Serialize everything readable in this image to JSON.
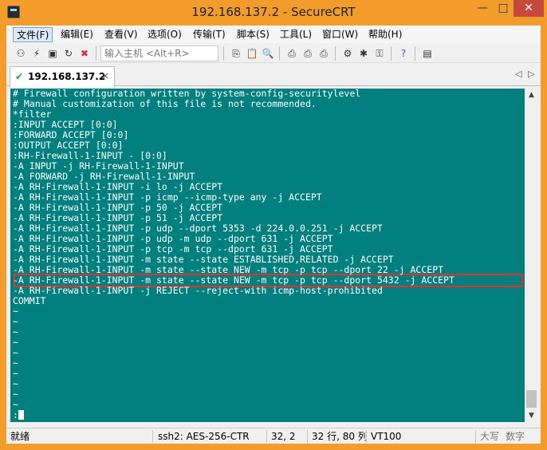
{
  "window": {
    "title": "192.168.137.2 - SecureCRT",
    "controls": {
      "minimize": "—",
      "maximize": "□",
      "close": "✕"
    }
  },
  "menu": {
    "items": [
      "文件(F)",
      "编辑(E)",
      "查看(V)",
      "选项(O)",
      "传输(T)",
      "脚本(S)",
      "工具(L)",
      "窗口(W)",
      "帮助(H)"
    ]
  },
  "toolbar": {
    "host_input_placeholder": "输入主机 <Alt+R>",
    "icons": [
      "connect-icon",
      "quick-connect-icon",
      "connect-in-tab-icon",
      "reconnect-icon",
      "disconnect-icon",
      "copy-icon",
      "paste-icon",
      "find-icon",
      "print-icon",
      "print-selection-icon",
      "print-setup-icon",
      "session-options-icon",
      "global-options-icon",
      "keymap-icon",
      "help-icon",
      "sftp-icon"
    ]
  },
  "tab": {
    "label": "192.168.137.2",
    "status_icon": "✔",
    "close_icon": "×",
    "nav_prev": "◁",
    "nav_next": "▷"
  },
  "terminal": {
    "lines": [
      "# Firewall configuration written by system-config-securitylevel",
      "# Manual customization of this file is not recommended.",
      "*filter",
      ":INPUT ACCEPT [0:0]",
      ":FORWARD ACCEPT [0:0]",
      ":OUTPUT ACCEPT [0:0]",
      ":RH-Firewall-1-INPUT - [0:0]",
      "-A INPUT -j RH-Firewall-1-INPUT",
      "-A FORWARD -j RH-Firewall-1-INPUT",
      "-A RH-Firewall-1-INPUT -i lo -j ACCEPT",
      "-A RH-Firewall-1-INPUT -p icmp --icmp-type any -j ACCEPT",
      "-A RH-Firewall-1-INPUT -p 50 -j ACCEPT",
      "-A RH-Firewall-1-INPUT -p 51 -j ACCEPT",
      "-A RH-Firewall-1-INPUT -p udp --dport 5353 -d 224.0.0.251 -j ACCEPT",
      "-A RH-Firewall-1-INPUT -p udp -m udp --dport 631 -j ACCEPT",
      "-A RH-Firewall-1-INPUT -p tcp -m tcp --dport 631 -j ACCEPT",
      "-A RH-Firewall-1-INPUT -m state --state ESTABLISHED,RELATED -j ACCEPT",
      "-A RH-Firewall-1-INPUT -m state --state NEW -m tcp -p tcp --dport 22 -j ACCEPT",
      "-A RH-Firewall-1-INPUT -m state --state NEW -m tcp -p tcp --dport 5432 -j ACCEPT",
      "-A RH-Firewall-1-INPUT -j REJECT --reject-with icmp-host-prohibited",
      "COMMIT",
      "~",
      "~",
      "~",
      "~",
      "~",
      "~",
      "~",
      "~",
      "~",
      "~"
    ],
    "prompt_line": ":",
    "highlighted_line_index": 18,
    "highlight_color": "#e3312b"
  },
  "scrollbar": {
    "up_arrow": "▲",
    "down_arrow": "▼"
  },
  "statusbar": {
    "ready": "就绪",
    "cipher": "ssh2: AES-256-CTR",
    "cursor_pos": "32,  2",
    "dimensions": "32 行, 80 列",
    "emulation": "VT100",
    "caps": "大写",
    "num": "数字"
  }
}
